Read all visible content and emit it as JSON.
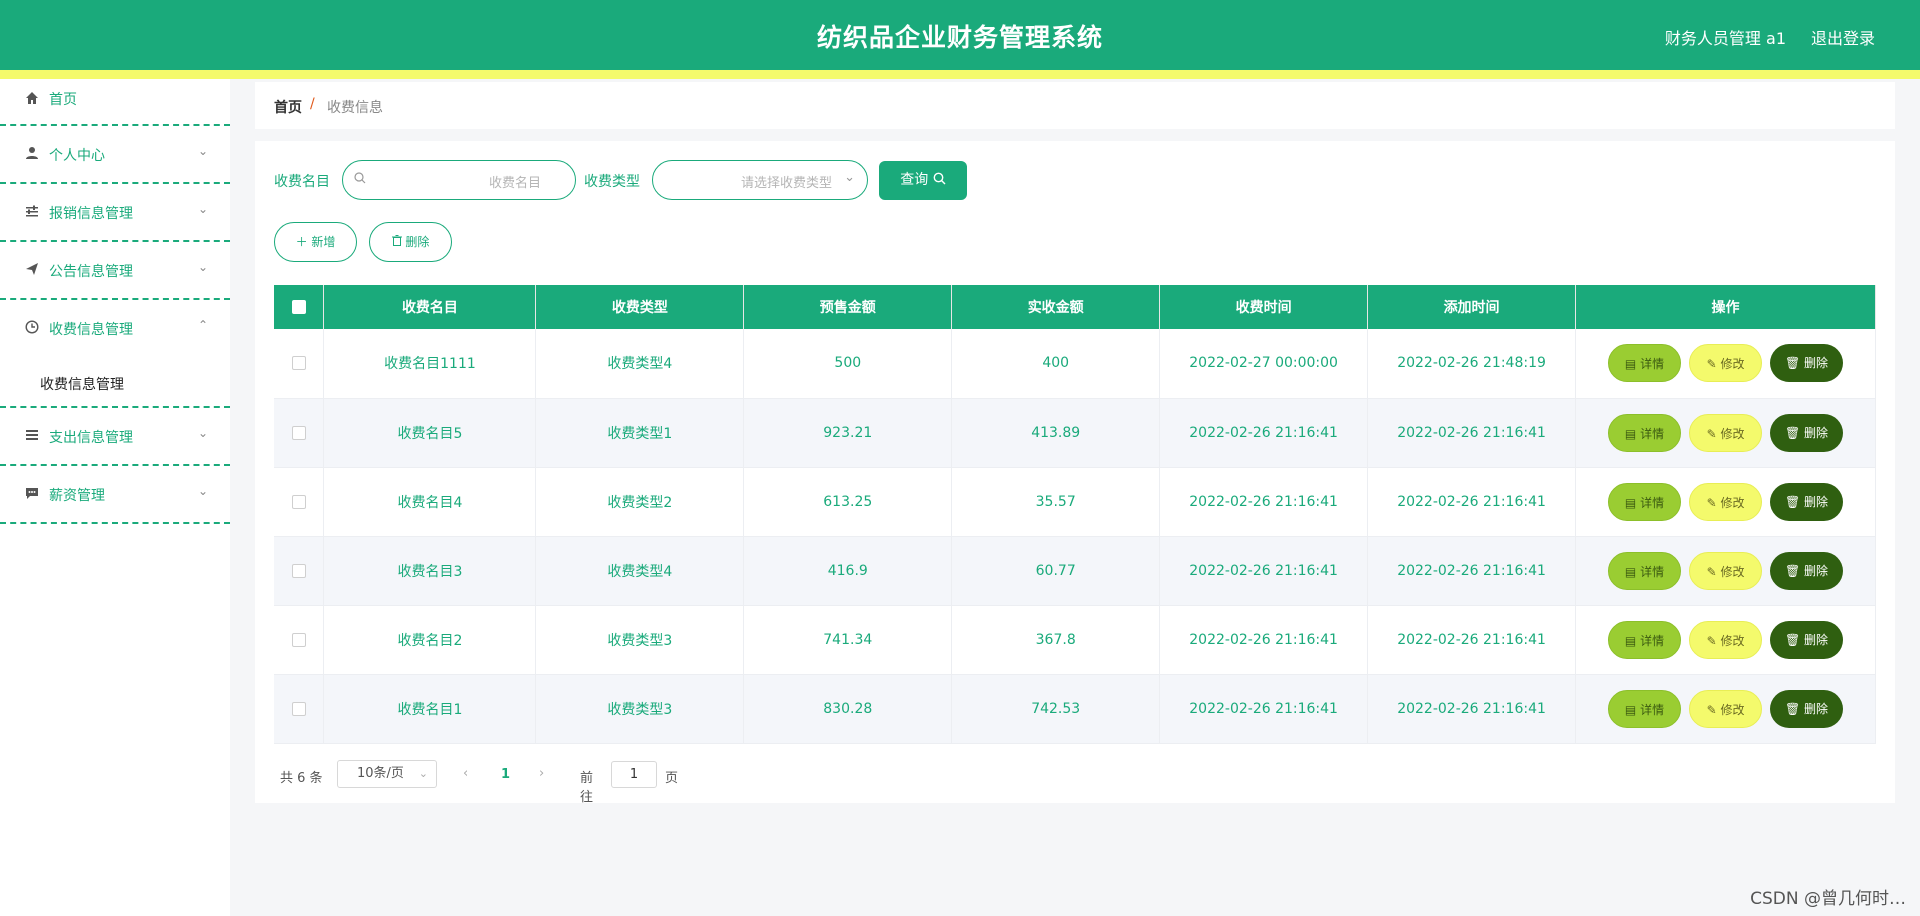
{
  "header": {
    "title": "纺织品企业财务管理系统",
    "user": "财务人员管理 a1",
    "logout": "退出登录",
    "color": "#1aaa7b",
    "stripe_color": "#f4fa6c"
  },
  "sidebar": {
    "items": [
      {
        "label": "首页",
        "icon": "home-icon"
      },
      {
        "label": "个人中心",
        "icon": "user-icon"
      },
      {
        "label": "报销信息管理",
        "icon": "sliders-icon"
      },
      {
        "label": "公告信息管理",
        "icon": "send-icon"
      },
      {
        "label": "收费信息管理",
        "icon": "clock-icon",
        "submenu": [
          "收费信息管理"
        ]
      },
      {
        "label": "支出信息管理",
        "icon": "list-icon"
      },
      {
        "label": "薪资管理",
        "icon": "chat-icon"
      }
    ]
  },
  "breadcrumb": {
    "home": "首页",
    "separator": "/",
    "current": "收费信息"
  },
  "search": {
    "name_label": "收费名目",
    "name_placeholder": "收费名目",
    "type_label": "收费类型",
    "type_placeholder": "请选择收费类型",
    "query_button": "查询"
  },
  "actions": {
    "add": "新增",
    "delete": "删除"
  },
  "table": {
    "columns": [
      "收费名目",
      "收费类型",
      "预售金额",
      "实收金额",
      "收费时间",
      "添加时间",
      "操作"
    ],
    "rows": [
      [
        "收费名目1111",
        "收费类型4",
        "500",
        "400",
        "2022-02-27 00:00:00",
        "2022-02-26 21:48:19"
      ],
      [
        "收费名目5",
        "收费类型1",
        "923.21",
        "413.89",
        "2022-02-26 21:16:41",
        "2022-02-26 21:16:41"
      ],
      [
        "收费名目4",
        "收费类型2",
        "613.25",
        "35.57",
        "2022-02-26 21:16:41",
        "2022-02-26 21:16:41"
      ],
      [
        "收费名目3",
        "收费类型4",
        "416.9",
        "60.77",
        "2022-02-26 21:16:41",
        "2022-02-26 21:16:41"
      ],
      [
        "收费名目2",
        "收费类型3",
        "741.34",
        "367.8",
        "2022-02-26 21:16:41",
        "2022-02-26 21:16:41"
      ],
      [
        "收费名目1",
        "收费类型3",
        "830.28",
        "742.53",
        "2022-02-26 21:16:41",
        "2022-02-26 21:16:41"
      ]
    ],
    "row_actions": {
      "detail": "详情",
      "edit": "修改",
      "delete": "删除"
    }
  },
  "pagination": {
    "total": "共 6 条",
    "page_size": "10条/页",
    "current": "1",
    "goto_prefix": "前往",
    "goto_value": "1",
    "goto_suffix": "页"
  },
  "watermark": "CSDN @曾几何时…"
}
